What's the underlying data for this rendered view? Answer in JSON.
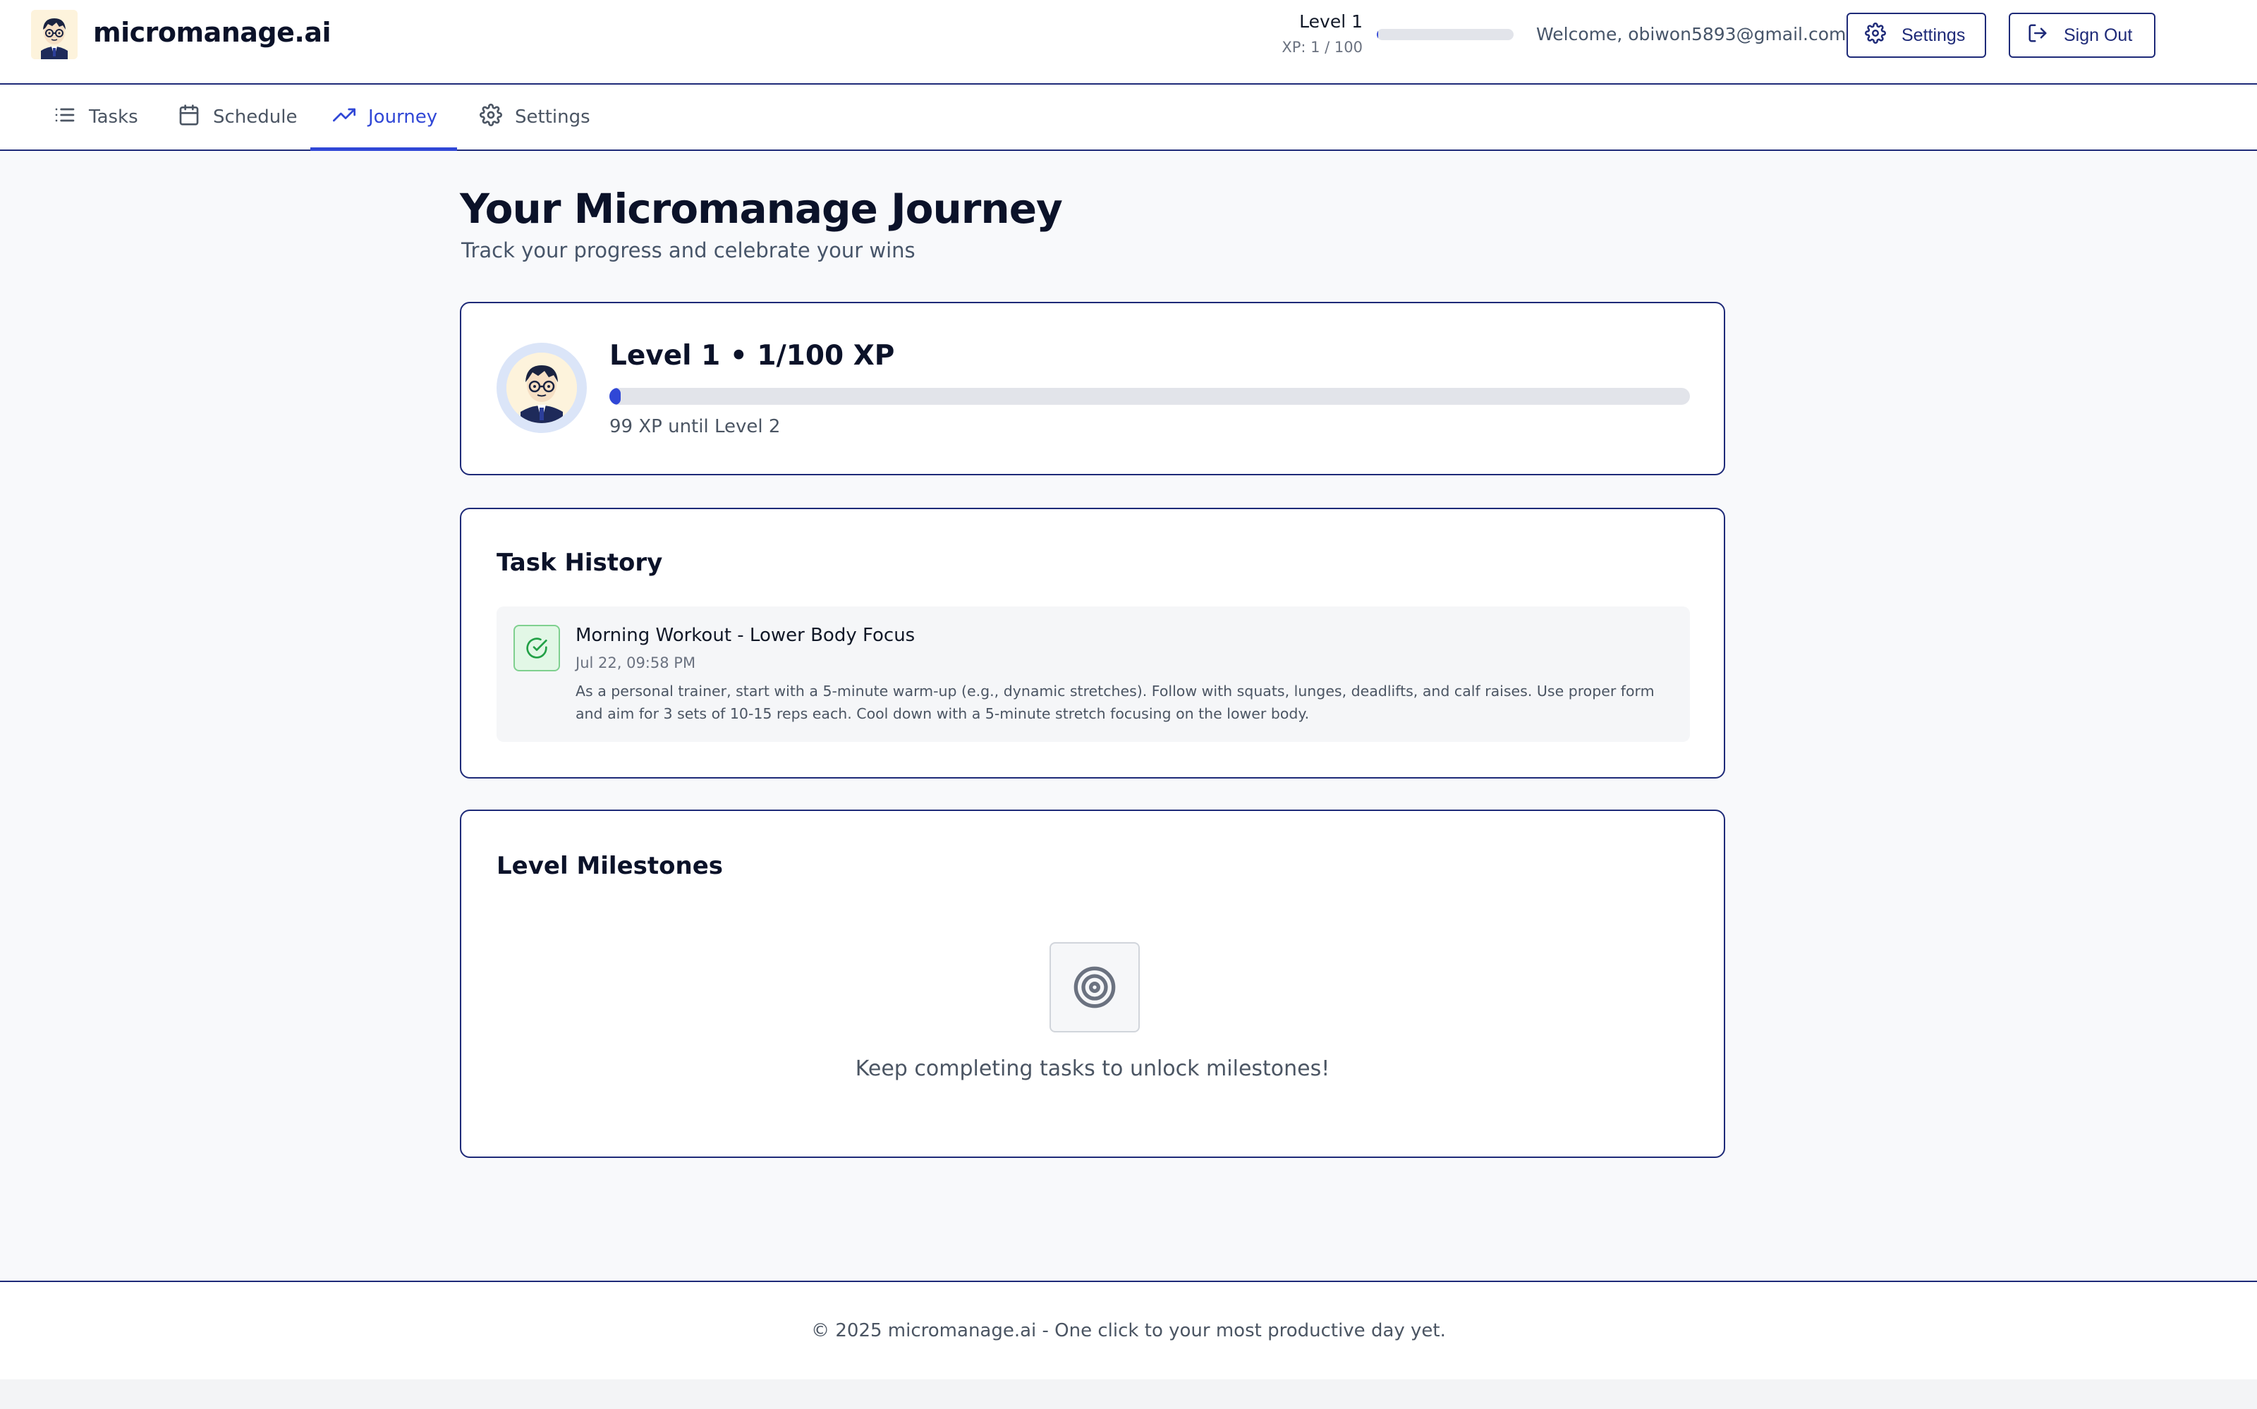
{
  "header": {
    "brand": "micromanage.ai",
    "level_label": "Level 1",
    "xp_label": "XP: 1 / 100",
    "xp_progress": 0.01,
    "welcome": "Welcome, obiwon5893@gmail.com",
    "settings_label": "Settings",
    "signout_label": "Sign Out"
  },
  "tabs": [
    {
      "label": "Tasks",
      "icon": "list-icon",
      "active": false
    },
    {
      "label": "Schedule",
      "icon": "calendar-icon",
      "active": false
    },
    {
      "label": "Journey",
      "icon": "trending-up-icon",
      "active": true
    },
    {
      "label": "Settings",
      "icon": "gear-icon",
      "active": false
    }
  ],
  "main": {
    "title": "Your Micromanage Journey",
    "subtitle": "Track your progress and celebrate your wins",
    "level_card": {
      "heading": "Level 1 • 1/100 XP",
      "progress": 0.01,
      "remaining": "99 XP until Level 2"
    },
    "history": {
      "title": "Task History",
      "items": [
        {
          "title": "Morning Workout - Lower Body Focus",
          "time": "Jul 22, 09:58 PM",
          "description": "As a personal trainer, start with a 5-minute warm-up (e.g., dynamic stretches). Follow with squats, lunges, deadlifts, and calf raises. Use proper form and aim for 3 sets of 10-15 reps each. Cool down with a 5-minute stretch focusing on the lower body.",
          "icon": "check-circle-icon"
        }
      ]
    },
    "milestones": {
      "title": "Level Milestones",
      "empty_text": "Keep completing tasks to unlock milestones!",
      "icon": "target-icon"
    }
  },
  "footer": {
    "text": "© 2025 micromanage.ai - One click to your most productive day yet."
  },
  "colors": {
    "accent": "#3047d6",
    "border": "#1e2a78",
    "success": "#7fd08f"
  }
}
